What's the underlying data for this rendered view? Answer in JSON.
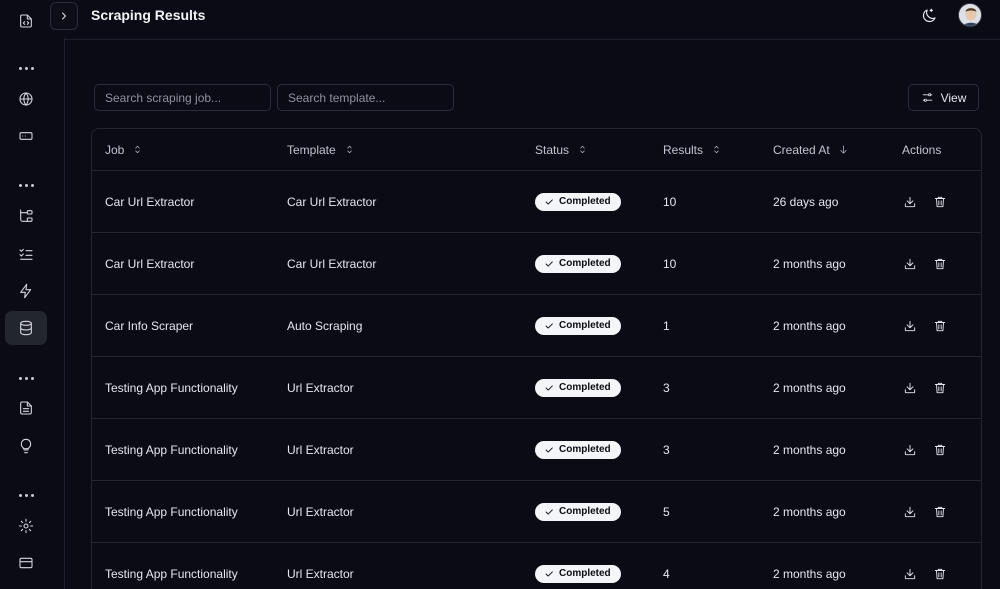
{
  "header": {
    "title": "Scraping Results",
    "toggle_icon": "chevron-right-icon",
    "theme_icon": "theme-toggle-icon",
    "avatar": "user-avatar"
  },
  "sidebar": {
    "items": [
      {
        "icon": "file-code-icon",
        "active": false
      },
      {
        "icon": "globe-icon",
        "active": false
      },
      {
        "icon": "rectangle-icon",
        "active": false
      },
      {
        "icon": "hierarchy-icon",
        "active": false
      },
      {
        "icon": "list-checks-icon",
        "active": false
      },
      {
        "icon": "zap-icon",
        "active": false
      },
      {
        "icon": "database-icon",
        "active": true
      },
      {
        "icon": "file-text-icon",
        "active": false
      },
      {
        "icon": "lightbulb-icon",
        "active": false
      },
      {
        "icon": "settings-icon",
        "active": false
      },
      {
        "icon": "credit-card-icon",
        "active": false
      }
    ]
  },
  "filters": {
    "job_placeholder": "Search scraping job...",
    "template_placeholder": "Search template...",
    "view_label": "View"
  },
  "table": {
    "columns": {
      "job": "Job",
      "template": "Template",
      "status": "Status",
      "results": "Results",
      "created_at": "Created At",
      "actions": "Actions"
    },
    "rows": [
      {
        "job": "Car Url Extractor",
        "template": "Car Url Extractor",
        "status": "Completed",
        "results": "10",
        "created_at": "26 days ago"
      },
      {
        "job": "Car Url Extractor",
        "template": "Car Url Extractor",
        "status": "Completed",
        "results": "10",
        "created_at": "2 months ago"
      },
      {
        "job": "Car Info Scraper",
        "template": "Auto Scraping",
        "status": "Completed",
        "results": "1",
        "created_at": "2 months ago"
      },
      {
        "job": "Testing App Functionality",
        "template": "Url Extractor",
        "status": "Completed",
        "results": "3",
        "created_at": "2 months ago"
      },
      {
        "job": "Testing App Functionality",
        "template": "Url Extractor",
        "status": "Completed",
        "results": "3",
        "created_at": "2 months ago"
      },
      {
        "job": "Testing App Functionality",
        "template": "Url Extractor",
        "status": "Completed",
        "results": "5",
        "created_at": "2 months ago"
      },
      {
        "job": "Testing App Functionality",
        "template": "Url Extractor",
        "status": "Completed",
        "results": "4",
        "created_at": "2 months ago"
      }
    ]
  }
}
